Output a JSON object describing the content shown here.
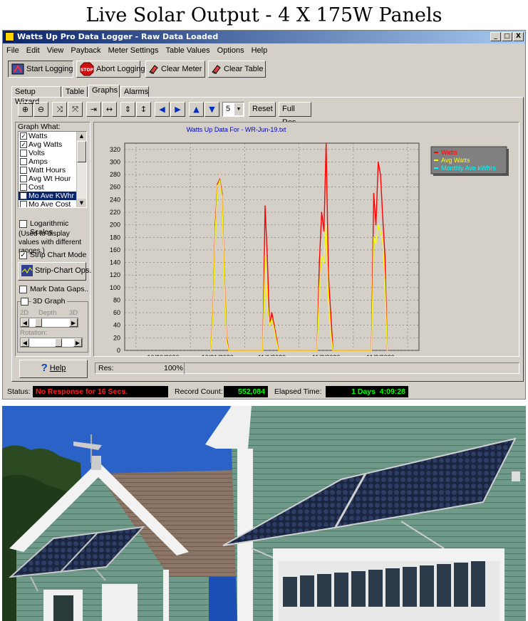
{
  "banner": {
    "title": "Live Solar Output - 4 X 175W Panels"
  },
  "window": {
    "title": "Watts Up Pro Data Logger - Raw Data Loaded",
    "buttons": {
      "minimize": "_",
      "maximize": "□",
      "close": "X"
    }
  },
  "menu": [
    "File",
    "Edit",
    "View",
    "Payback",
    "Meter Settings",
    "Table Values",
    "Options",
    "Help"
  ],
  "toolbar": {
    "start_label": "Start Logging",
    "abort_label": "Abort Logging",
    "stop_text": "STOP",
    "clear_meter_label": "Clear Meter",
    "clear_table_label": "Clear Table"
  },
  "tabs": [
    "Setup Wizard",
    "Table",
    "Graphs",
    "Alarms"
  ],
  "graph_toolbar": {
    "points_value": "5",
    "reset_label": "Reset",
    "full_res_label": "Full Res"
  },
  "left_panel": {
    "graph_what_label": "Graph What:",
    "items": [
      {
        "label": "Watts",
        "checked": true
      },
      {
        "label": "Avg Watts",
        "checked": true
      },
      {
        "label": "Volts",
        "checked": false
      },
      {
        "label": "Amps",
        "checked": false
      },
      {
        "label": "Watt Hours",
        "checked": false
      },
      {
        "label": "Avg Wt Hour",
        "checked": false
      },
      {
        "label": "Cost",
        "checked": false
      },
      {
        "label": "Mo Ave KWhr",
        "checked": true
      },
      {
        "label": "Mo Ave Cost",
        "checked": false
      }
    ],
    "log_scales_label": "Logarithmic Scales",
    "log_note": "(Used to display values with different ranges.)",
    "strip_chart_label": "Strip Chart Mode",
    "strip_ops_label": "Strip-Chart Ops.",
    "mark_gaps_label": "Mark Data Gaps..",
    "graph3d_label": "3D Graph",
    "label_2d": "2D",
    "label_depth": "Depth",
    "label_3d": "3D",
    "rotation_label": "Rotation:",
    "help_label": "Help"
  },
  "res_bar": {
    "label": "Res:",
    "value": "100%"
  },
  "status": {
    "status_label": "Status:",
    "status_value": "No Response for 16 Secs.",
    "record_label": "Record Count:",
    "record_value": "552,084",
    "elapsed_label": "Elapsed Time:",
    "elapsed_value": "1 Days  4:09:28"
  },
  "colors": {
    "watts": "#ff0000",
    "avg_watts": "#ffff00",
    "monthly": "#00ffff",
    "status_red": "#ff2020",
    "status_green": "#00ff00"
  },
  "chart_data": {
    "type": "line",
    "title": "Watts Up Data For - WR-Jun-19.txt",
    "xlabel": "",
    "ylabel": "",
    "ylim": [
      0,
      330
    ],
    "yticks": [
      0,
      20,
      40,
      60,
      80,
      100,
      120,
      140,
      160,
      180,
      200,
      220,
      240,
      260,
      280,
      300,
      320
    ],
    "xlim": [
      "2020-10-29 19:00",
      "2020-11-04 05:00"
    ],
    "xtick_labels": [
      "10/30/2020",
      "10/31/2020",
      "11/1/2020",
      "11/2/2020",
      "11/3/2020"
    ],
    "grid": true,
    "legend_position": "top-right",
    "series": [
      {
        "name": "Watts",
        "x": [
          "2020-10-31 09:00",
          "2020-10-31 10:00",
          "2020-10-31 11:00",
          "2020-10-31 12:00",
          "2020-10-31 13:00",
          "2020-10-31 14:00",
          "2020-10-31 15:00",
          "2020-10-31 16:00",
          "2020-10-31 17:00",
          "2020-11-01 08:00",
          "2020-11-01 09:00",
          "2020-11-01 10:00",
          "2020-11-01 11:00",
          "2020-11-01 12:00",
          "2020-11-01 13:00",
          "2020-11-01 14:00",
          "2020-11-01 15:00",
          "2020-11-02 08:00",
          "2020-11-02 09:00",
          "2020-11-02 10:00",
          "2020-11-02 11:00",
          "2020-11-02 12:00",
          "2020-11-02 13:00",
          "2020-11-02 14:00",
          "2020-11-02 15:00",
          "2020-11-03 08:00",
          "2020-11-03 09:00",
          "2020-11-03 10:00",
          "2020-11-03 11:00",
          "2020-11-03 12:00",
          "2020-11-03 13:00",
          "2020-11-03 14:00",
          "2020-11-03 15:00"
        ],
        "y": [
          0,
          60,
          200,
          265,
          272,
          250,
          120,
          20,
          0,
          0,
          230,
          150,
          40,
          60,
          40,
          20,
          0,
          0,
          140,
          220,
          190,
          330,
          120,
          60,
          0,
          0,
          250,
          200,
          300,
          280,
          210,
          150,
          0
        ]
      },
      {
        "name": "Avg Watts",
        "x": [
          "2020-10-31 09:00",
          "2020-10-31 10:00",
          "2020-10-31 11:00",
          "2020-10-31 12:00",
          "2020-10-31 13:00",
          "2020-10-31 14:00",
          "2020-10-31 15:00",
          "2020-10-31 16:00",
          "2020-10-31 17:00",
          "2020-11-01 08:00",
          "2020-11-01 09:00",
          "2020-11-01 10:00",
          "2020-11-01 11:00",
          "2020-11-01 12:00",
          "2020-11-01 13:00",
          "2020-11-01 14:00",
          "2020-11-01 15:00",
          "2020-11-02 08:00",
          "2020-11-02 09:00",
          "2020-11-02 10:00",
          "2020-11-02 11:00",
          "2020-11-02 12:00",
          "2020-11-02 13:00",
          "2020-11-02 14:00",
          "2020-11-02 15:00",
          "2020-11-03 08:00",
          "2020-11-03 09:00",
          "2020-11-03 10:00",
          "2020-11-03 11:00",
          "2020-11-03 12:00",
          "2020-11-03 13:00",
          "2020-11-03 14:00",
          "2020-11-03 15:00"
        ],
        "y": [
          0,
          55,
          190,
          262,
          270,
          245,
          115,
          15,
          0,
          0,
          150,
          80,
          40,
          50,
          35,
          15,
          0,
          0,
          100,
          150,
          140,
          200,
          80,
          30,
          0,
          0,
          180,
          170,
          200,
          190,
          170,
          110,
          0
        ]
      },
      {
        "name": "Monthly Ave kWhrs",
        "x": [],
        "y": []
      }
    ]
  }
}
